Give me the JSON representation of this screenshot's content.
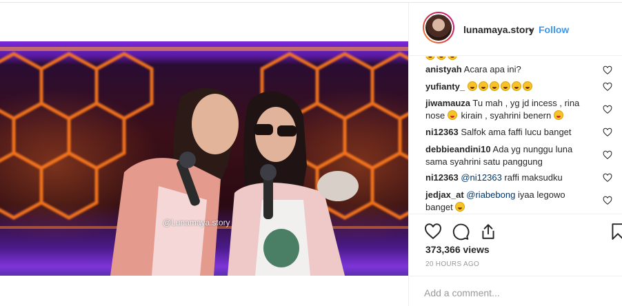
{
  "post": {
    "username": "lunamaya.story",
    "separator": "•",
    "follow_label": "Follow",
    "watermark": "@Lunamaya.story",
    "views": "373,366 views",
    "time": "20 HOURS AGO"
  },
  "comments": [
    {
      "user": "anistyah",
      "text": "Acara apa ini?"
    },
    {
      "user": "yufianty_",
      "text": ""
    },
    {
      "user": "jiwamauza",
      "text": "Tu mah , yg jd incess , rina",
      "text2": "nose",
      "text3": "kirain , syahrini benern"
    },
    {
      "user": "ni12363",
      "text": "Salfok ama faffi lucu banget"
    },
    {
      "user": "debbieandini10",
      "text": "Ada yg nunggu luna",
      "text2": "sama syahrini satu panggung"
    },
    {
      "user": "ni12363",
      "mention": "@ni12363",
      "text": "raffi maksudku"
    },
    {
      "user": "jedjax_at",
      "mention": "@riabebong",
      "text": "iyaa legowo",
      "text2": "banget"
    }
  ],
  "add_comment": {
    "placeholder": "Add a comment..."
  },
  "icons": {
    "like": "heart-icon",
    "comment": "comment-icon",
    "share": "share-icon",
    "save": "bookmark-icon",
    "comment_like": "heart-icon",
    "profile": "user-icon"
  },
  "colors": {
    "follow": "#3897f0",
    "mention": "#003569",
    "time": "#999999"
  }
}
